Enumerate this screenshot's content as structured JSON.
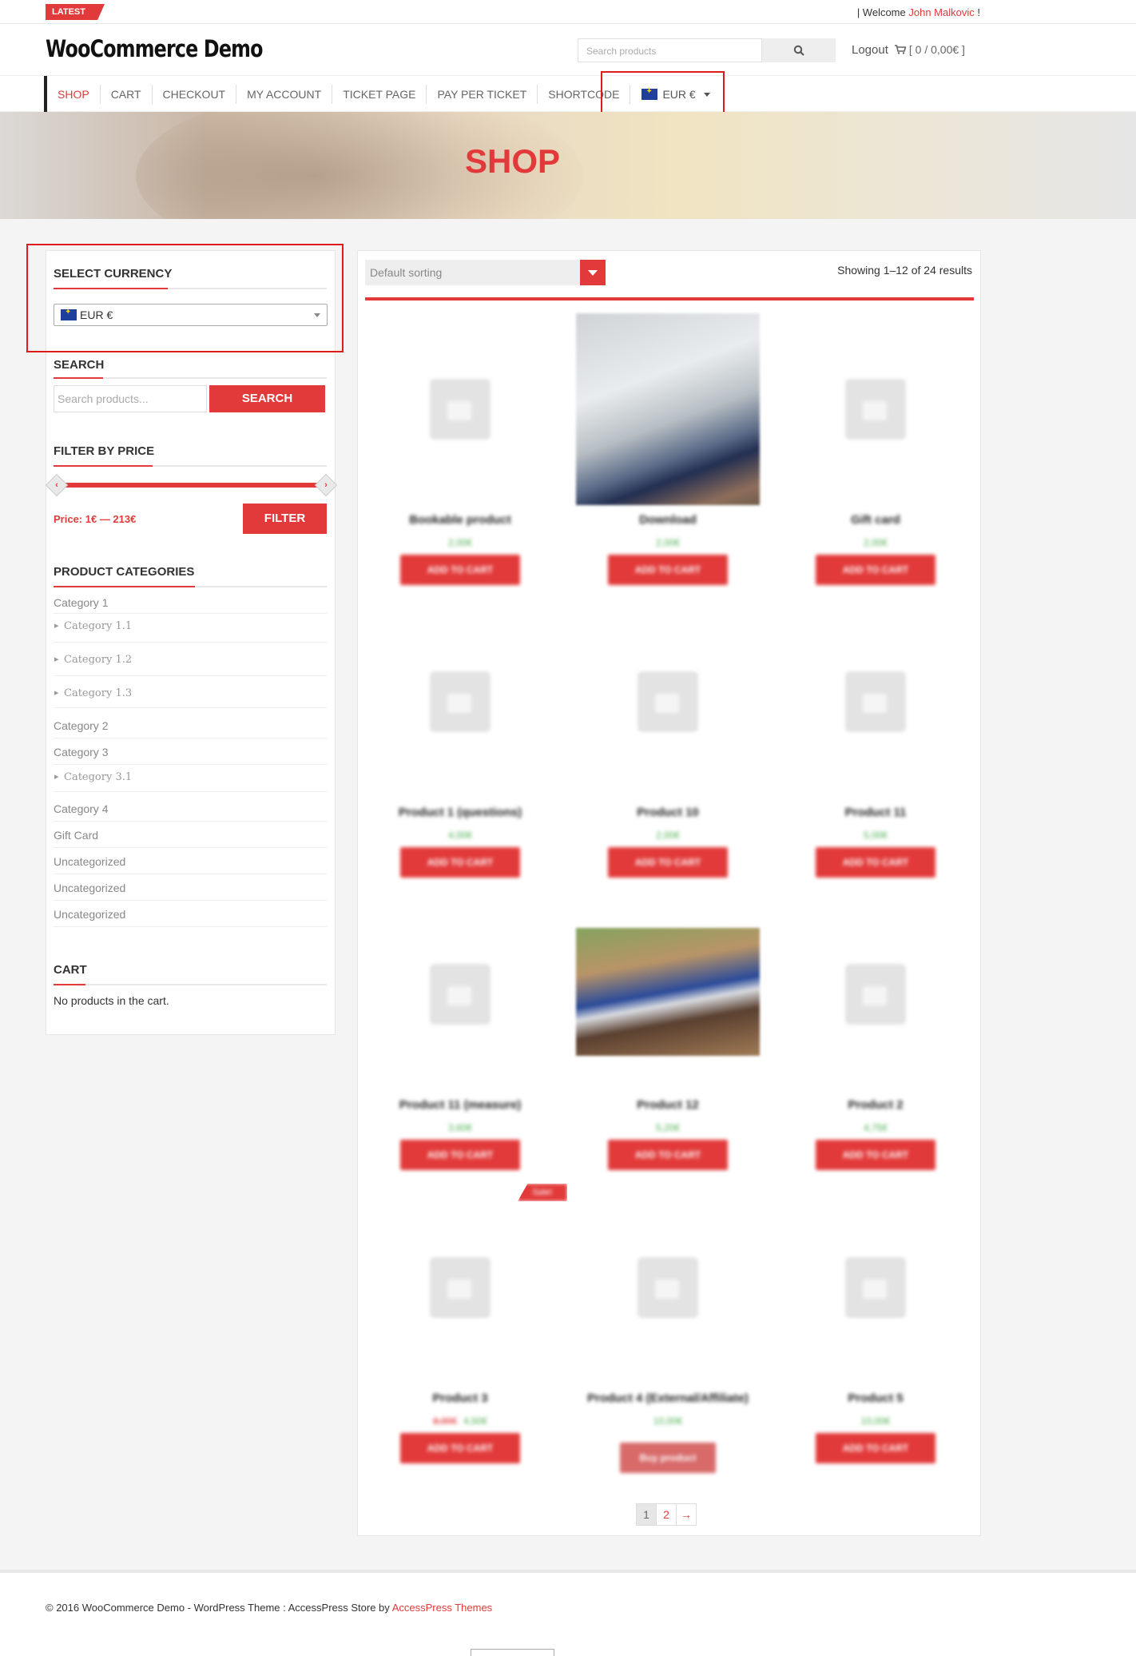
{
  "topbar": {
    "latest_label": "LATEST",
    "welcome_prefix": "| Welcome",
    "welcome_user": "John Malkovic",
    "welcome_suffix": "!"
  },
  "header": {
    "logo": "WooCommerce Demo",
    "search_placeholder": "Search products",
    "logout": "Logout",
    "cart_summary": "[ 0 / 0,00€ ]"
  },
  "nav": {
    "items": [
      "SHOP",
      "CART",
      "CHECKOUT",
      "MY ACCOUNT",
      "TICKET PAGE",
      "PAY PER TICKET",
      "SHORTCODE"
    ],
    "active_item": "SHOP",
    "currency": "EUR €"
  },
  "hero": {
    "title": "SHOP"
  },
  "sidebar": {
    "currency_title": "SELECT CURRENCY",
    "currency_selected": "EUR €",
    "search_title": "SEARCH",
    "search_placeholder": "Search products...",
    "search_button": "SEARCH",
    "price_title": "FILTER BY PRICE",
    "price_range": "Price: 1€ — 213€",
    "filter_button": "FILTER",
    "categories_title": "PRODUCT CATEGORIES",
    "categories": [
      {
        "label": "Category 1",
        "sub": false
      },
      {
        "label": "Category 1.1",
        "sub": true
      },
      {
        "label": "Category 1.2",
        "sub": true
      },
      {
        "label": "Category 1.3",
        "sub": true
      },
      {
        "label": "Category 2",
        "sub": false
      },
      {
        "label": "Category 3",
        "sub": false
      },
      {
        "label": "Category 3.1",
        "sub": true
      },
      {
        "label": "Category 4",
        "sub": false
      },
      {
        "label": "Gift Card",
        "sub": false
      },
      {
        "label": "Uncategorized",
        "sub": false
      },
      {
        "label": "Uncategorized",
        "sub": false
      },
      {
        "label": "Uncategorized",
        "sub": false
      }
    ],
    "cart_title": "CART",
    "cart_empty": "No products in the cart."
  },
  "main": {
    "sort_label": "Default sorting",
    "results": "Showing 1–12 of 24 results",
    "products": [
      {
        "name": "Bookable product",
        "price": "2,00€",
        "button": "ADD TO CART",
        "image": "placeholder"
      },
      {
        "name": "Download",
        "price": "2,00€",
        "button": "ADD TO CART",
        "image": "car-photo"
      },
      {
        "name": "Gift card",
        "price": "2,00€",
        "button": "ADD TO CART",
        "image": "placeholder"
      },
      {
        "name": "Product 1 (questions)",
        "price": "4,00€",
        "button": "ADD TO CART",
        "image": "placeholder"
      },
      {
        "name": "Product 10",
        "price": "2,00€",
        "button": "ADD TO CART",
        "image": "placeholder"
      },
      {
        "name": "Product 11",
        "price": "5,00€",
        "button": "ADD TO CART",
        "image": "placeholder"
      },
      {
        "name": "Product 11 (measure)",
        "price": "3,60€",
        "button": "ADD TO CART",
        "image": "placeholder"
      },
      {
        "name": "Product 12",
        "price": "5,20€",
        "button": "ADD TO CART",
        "image": "car-photo-wide"
      },
      {
        "name": "Product 2",
        "price": "4,75€",
        "button": "ADD TO CART",
        "image": "placeholder"
      },
      {
        "name": "Product 3",
        "price": "4,50€",
        "old_price": "8,00€",
        "button": "ADD TO CART",
        "image": "placeholder",
        "badge": "Sale!"
      },
      {
        "name": "Product 4 (External/Affiliate)",
        "price": "10,00€",
        "button": "Buy product",
        "image": "placeholder"
      },
      {
        "name": "Product 5",
        "price": "10,00€",
        "button": "ADD TO CART",
        "image": "placeholder"
      }
    ],
    "pagination": [
      "1",
      "2",
      "→"
    ],
    "current_page": "1"
  },
  "footer": {
    "text": "© 2016 WooCommerce Demo - WordPress Theme : AccessPress Store by",
    "link": "AccessPress Themes"
  },
  "colors": {
    "accent": "#e23a3a",
    "highlight_outline": "#e01b1b",
    "price_green": "#4caf50"
  }
}
